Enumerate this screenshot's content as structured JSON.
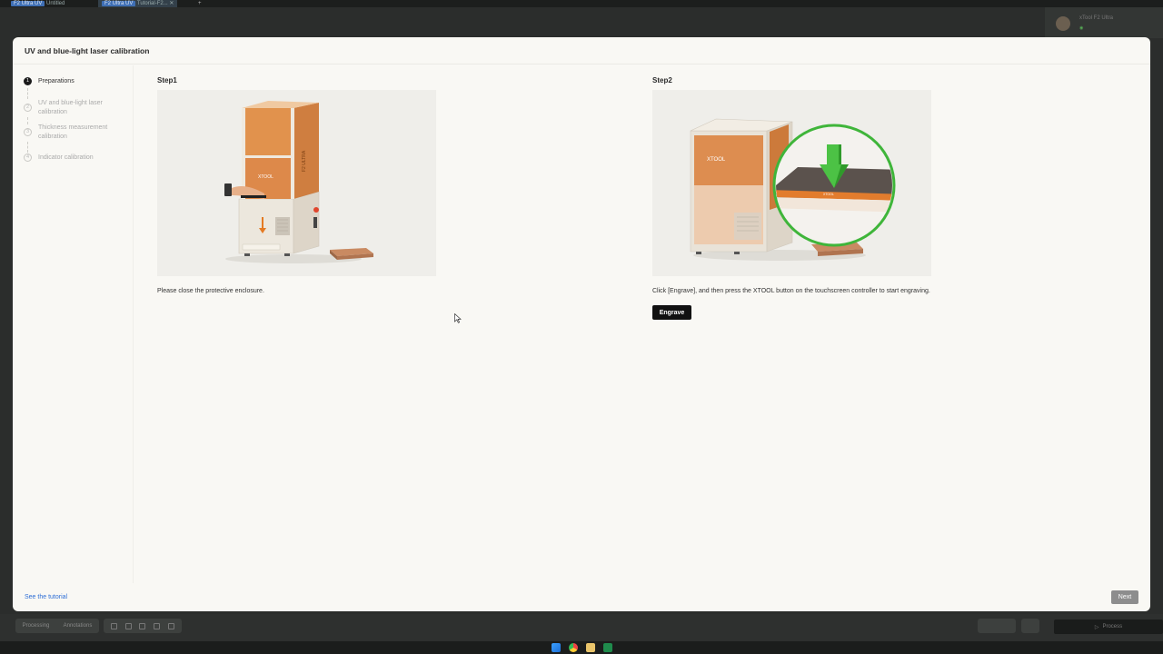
{
  "background": {
    "tabs": [
      {
        "chip": "F2 Ultra UV",
        "label": "Untitled"
      },
      {
        "chip": "F2 Ultra UV",
        "label": "Tutorial-F2..."
      }
    ],
    "device_name": "xTool F2 Ultra",
    "mode_tabs": [
      "Processing",
      "Annotations"
    ],
    "process_label": "Process"
  },
  "dialog": {
    "title": "UV and blue-light laser calibration",
    "steps": [
      {
        "number": "1",
        "label": "Preparations",
        "active": true
      },
      {
        "number": "2",
        "label": "UV and blue-light laser calibration",
        "active": false
      },
      {
        "number": "3",
        "label": "Thickness measurement calibration",
        "active": false
      },
      {
        "number": "4",
        "label": "Indicator calibration",
        "active": false
      }
    ],
    "step1": {
      "heading": "Step1",
      "description": "Please close the protective enclosure."
    },
    "step2": {
      "heading": "Step2",
      "description": "Click [Engrave], and then press the XTOOL button on the touchscreen controller to start engraving.",
      "button_label": "Engrave"
    },
    "footer": {
      "tutorial_link": "See the tutorial",
      "next_label": "Next"
    }
  },
  "illustration_text": {
    "brand": "XTOOL"
  },
  "colors": {
    "accent_orange": "#d9772e",
    "highlight_green": "#3fb53a",
    "link_blue": "#2f6fd6",
    "primary_button": "#111111",
    "disabled_button": "#8d8d8d"
  }
}
